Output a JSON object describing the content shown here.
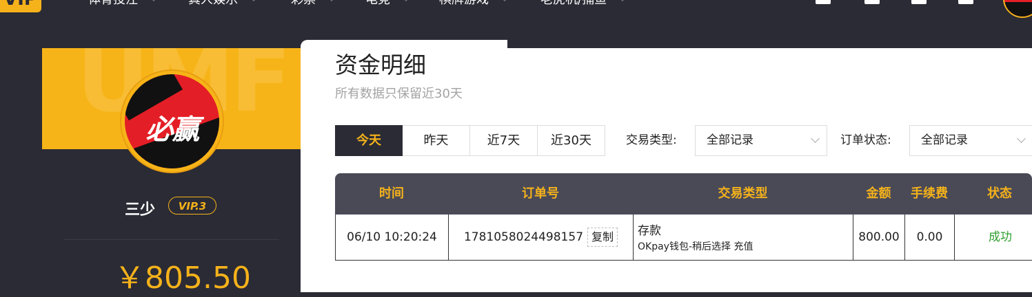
{
  "nav": {
    "logo_text": "VIP",
    "items": [
      {
        "label": "体育投注"
      },
      {
        "label": "真人娱乐"
      },
      {
        "label": "彩票"
      },
      {
        "label": "电竞"
      },
      {
        "label": "棋牌游戏"
      },
      {
        "label": "老虎机/捕鱼"
      }
    ]
  },
  "sidebar": {
    "watermark": "UMF",
    "avatar_brand": "必赢",
    "username": "三少",
    "vip_badge": "VIP.3",
    "balance": "￥805.50"
  },
  "main": {
    "title": "资金明细",
    "subtitle": "所有数据只保留近30天",
    "tabs": [
      {
        "label": "今天",
        "active": true
      },
      {
        "label": "昨天",
        "active": false
      },
      {
        "label": "近7天",
        "active": false
      },
      {
        "label": "近30天",
        "active": false
      }
    ],
    "filters": {
      "type_label": "交易类型:",
      "type_value": "全部记录",
      "status_label": "订单状态:",
      "status_value": "全部记录"
    },
    "table": {
      "headers": [
        "时间",
        "订单号",
        "交易类型",
        "金额",
        "手续费",
        "状态"
      ],
      "rows": [
        {
          "time": "06/10 10:20:24",
          "order_no": "1781058024498157",
          "copy_label": "复制",
          "type": "存款",
          "type_detail": "OKpay钱包-稍后选择 充值",
          "amount": "800.00",
          "fee": "0.00",
          "status": "成功"
        }
      ]
    }
  },
  "colors": {
    "accent": "#f5b21a",
    "dark": "#2b2b35",
    "header_row": "#4a4a57",
    "success": "#2f9e2f"
  }
}
